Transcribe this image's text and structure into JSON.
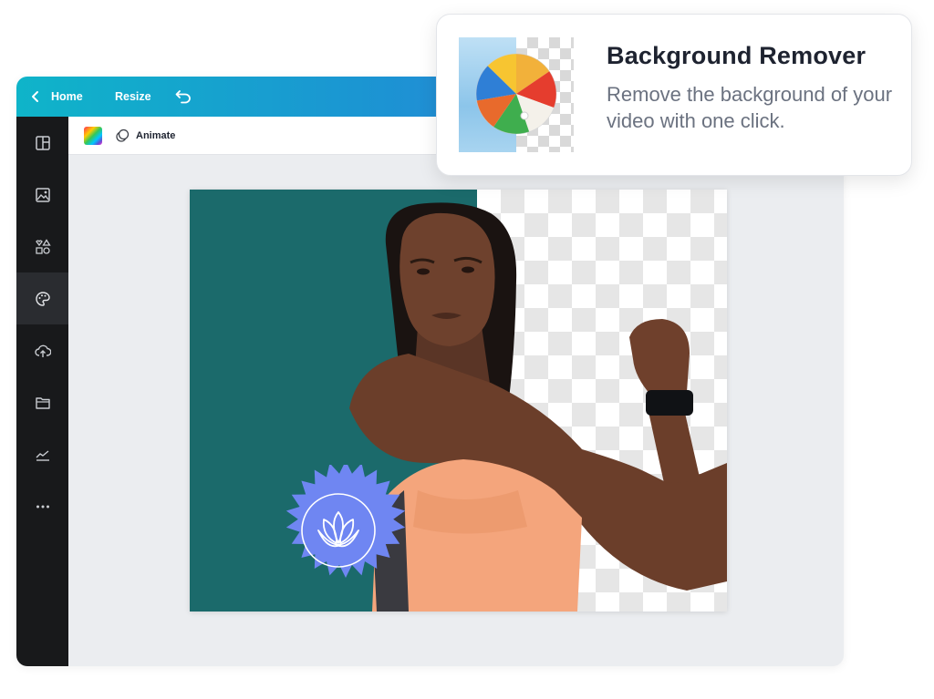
{
  "topbar": {
    "home_label": "Home",
    "resize_label": "Resize",
    "back_icon": "chevron-left-icon",
    "undo_icon": "undo-icon"
  },
  "sidebar": {
    "items": [
      {
        "icon": "templates-icon",
        "active": false
      },
      {
        "icon": "photos-icon",
        "active": false
      },
      {
        "icon": "elements-icon",
        "active": false
      },
      {
        "icon": "styles-icon",
        "active": true
      },
      {
        "icon": "uploads-icon",
        "active": false
      },
      {
        "icon": "folder-icon",
        "active": false
      },
      {
        "icon": "charts-icon",
        "active": false
      },
      {
        "icon": "more-icon",
        "active": false
      }
    ]
  },
  "toolbar": {
    "color_swatch_icon": "color-gradient-icon",
    "animate_icon": "animate-icon",
    "animate_label": "Animate"
  },
  "card": {
    "title": "Background Remover",
    "description": "Remove the background of your video with one click."
  },
  "colors": {
    "topbar_start": "#0fb4c9",
    "topbar_end": "#4a6fe0",
    "sidebar_bg": "#18191b",
    "canvas_bg": "#1b6a6b",
    "badge": "#6f86f2",
    "top": "#f4a57c"
  }
}
